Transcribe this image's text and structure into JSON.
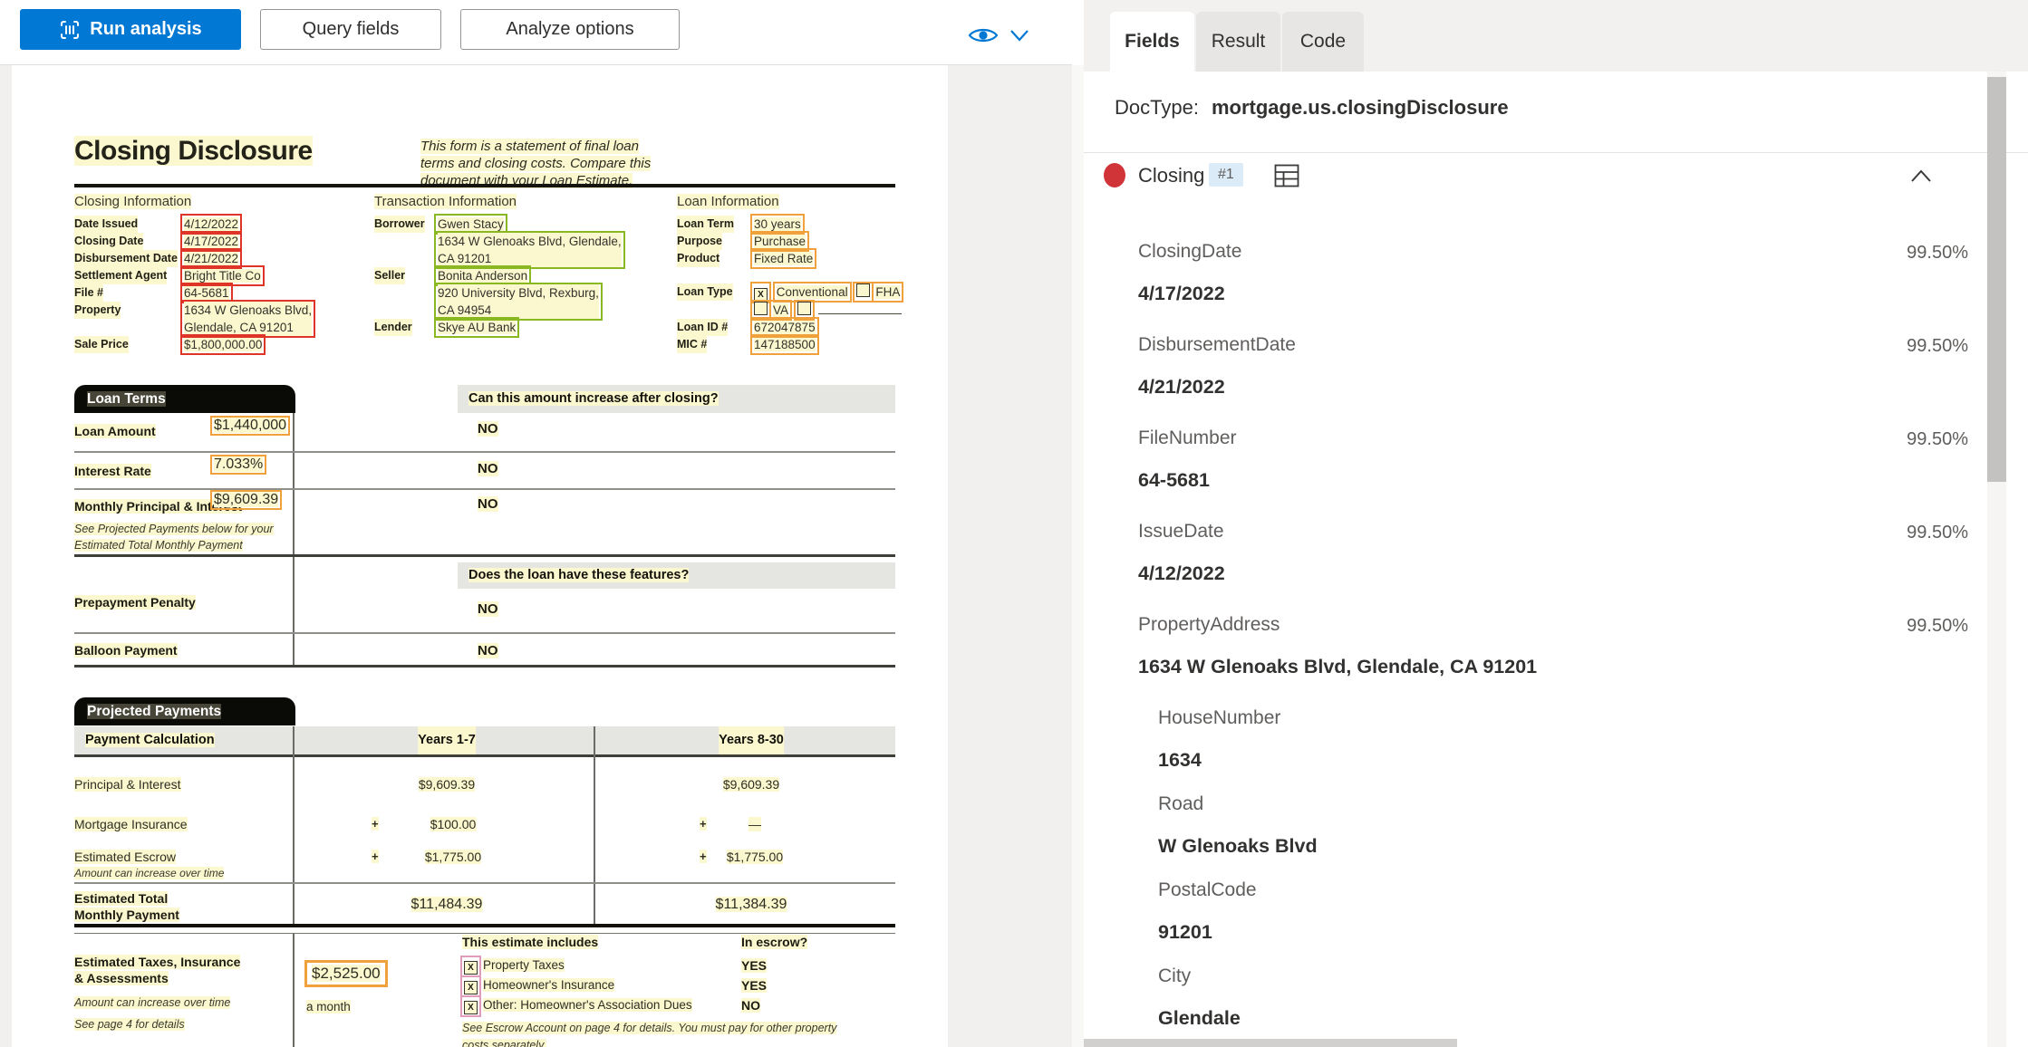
{
  "toolbar": {
    "run_analysis": "Run analysis",
    "query_fields": "Query fields",
    "analyze_options": "Analyze options"
  },
  "panel": {
    "tabs": [
      "Fields",
      "Result",
      "Code"
    ],
    "doctype_label": "DocType:",
    "doctype_value": "mortgage.us.closingDisclosure",
    "section": {
      "name": "Closing",
      "badge": "#1"
    },
    "fields": [
      {
        "name": "ClosingDate",
        "value": "4/17/2022",
        "confidence": "99.50%"
      },
      {
        "name": "DisbursementDate",
        "value": "4/21/2022",
        "confidence": "99.50%"
      },
      {
        "name": "FileNumber",
        "value": "64-5681",
        "confidence": "99.50%"
      },
      {
        "name": "IssueDate",
        "value": "4/12/2022",
        "confidence": "99.50%"
      },
      {
        "name": "PropertyAddress",
        "value": "1634 W Glenoaks Blvd, Glendale, CA 91201",
        "confidence": "99.50%"
      },
      {
        "name": "HouseNumber",
        "value": "1634",
        "confidence": ""
      },
      {
        "name": "Road",
        "value": "W Glenoaks Blvd",
        "confidence": ""
      },
      {
        "name": "PostalCode",
        "value": "91201",
        "confidence": ""
      },
      {
        "name": "City",
        "value": "Glendale",
        "confidence": ""
      }
    ],
    "accent_colors": {
      "primary_blue": "#0078d4",
      "section_dot_red": "#d13438",
      "badge_blue": "#dcebf8"
    }
  },
  "document": {
    "title": "Closing Disclosure",
    "intro": "This form is a statement of final loan terms and closing costs. Compare this document with your Loan Estimate.",
    "closing_information": {
      "heading": "Closing Information",
      "rows": [
        {
          "label": "Date Issued",
          "value": "4/12/2022"
        },
        {
          "label": "Closing Date",
          "value": "4/17/2022"
        },
        {
          "label": "Disbursement Date",
          "value": "4/21/2022"
        },
        {
          "label": "Settlement Agent",
          "value": "Bright Title Co"
        },
        {
          "label": "File #",
          "value": "64-5681"
        },
        {
          "label": "Property",
          "value": "1634 W Glenoaks Blvd,",
          "value_line2": "Glendale, CA 91201"
        },
        {
          "label": "Sale Price",
          "value": "$1,800,000.00"
        }
      ]
    },
    "transaction_information": {
      "heading": "Transaction Information",
      "rows": [
        {
          "label": "Borrower",
          "name": "Gwen Stacy",
          "addr1": "1634 W Glenoaks Blvd, Glendale,",
          "addr2": "CA 91201"
        },
        {
          "label": "Seller",
          "name": "Bonita Anderson",
          "addr1": "920 University Blvd, Rexburg,",
          "addr2": "CA 94954"
        },
        {
          "label": "Lender",
          "name": "Skye AU Bank"
        }
      ]
    },
    "loan_information": {
      "heading": "Loan Information",
      "rows": [
        {
          "label": "Loan Term",
          "value": "30 years"
        },
        {
          "label": "Purpose",
          "value": "Purchase"
        },
        {
          "label": "Product",
          "value": "Fixed Rate"
        }
      ],
      "loan_type_label": "Loan Type",
      "loan_type_options": [
        {
          "mark": "X",
          "label": "Conventional"
        },
        {
          "mark": "",
          "label": "FHA"
        },
        {
          "mark": "",
          "label": "VA"
        },
        {
          "mark": "",
          "label": ""
        }
      ],
      "rows2": [
        {
          "label": "Loan ID #",
          "value": "672047875"
        },
        {
          "label": "MIC #",
          "value": "147188500"
        }
      ]
    },
    "loan_terms": {
      "tab": "Loan Terms",
      "question1": "Can this amount increase after closing?",
      "rows": [
        {
          "label": "Loan Amount",
          "value": "$1,440,000",
          "answer": "NO"
        },
        {
          "label": "Interest Rate",
          "value": "7.033%",
          "answer": "NO"
        },
        {
          "label": "Monthly Principal & Interest",
          "value": "$9,609.39",
          "answer": "NO",
          "note1": "See Projected Payments below for your",
          "note2": "Estimated Total Monthly Payment"
        }
      ],
      "question2": "Does the loan have these features?",
      "rows2": [
        {
          "label": "Prepayment Penalty",
          "answer": "NO"
        },
        {
          "label": "Balloon Payment",
          "answer": "NO"
        }
      ]
    },
    "projected_payments": {
      "tab": "Projected Payments",
      "header": [
        "Payment Calculation",
        "Years 1-7",
        "Years 8-30"
      ],
      "rows": [
        {
          "label": "Principal & Interest",
          "y1_plus": "",
          "y1": "$9,609.39",
          "y2_plus": "",
          "y2": "$9,609.39"
        },
        {
          "label": "Mortgage Insurance",
          "y1_plus": "+",
          "y1": "$100.00",
          "y2_plus": "+",
          "y2": "—"
        },
        {
          "label": "Estimated Escrow",
          "note": "Amount can increase over time",
          "y1_plus": "+",
          "y1": "$1,775.00",
          "y2_plus": "+",
          "y2": "$1,775.00"
        }
      ],
      "total_label1": "Estimated Total",
      "total_label2": "Monthly Payment",
      "total_y1": "$11,484.39",
      "total_y2": "$11,384.39"
    },
    "estimated_taxes": {
      "label1": "Estimated Taxes, Insurance",
      "label2": "& Assessments",
      "note1": "Amount can increase over time",
      "note2": "See page 4 for details",
      "amount": "$2,525.00",
      "amount_suffix": "a month",
      "includes_heading": "This estimate includes",
      "items": [
        {
          "mark": "X",
          "text": "Property Taxes",
          "escrow": "YES"
        },
        {
          "mark": "X",
          "text": "Homeowner's Insurance",
          "escrow": "YES"
        },
        {
          "mark": "X",
          "text": "Other: Homeowner's Association Dues",
          "escrow": "NO"
        }
      ],
      "escrow_heading": "In escrow?",
      "footnote1": "See Escrow Account on page 4 for details. You must pay for other property",
      "footnote2": "costs separately."
    }
  }
}
